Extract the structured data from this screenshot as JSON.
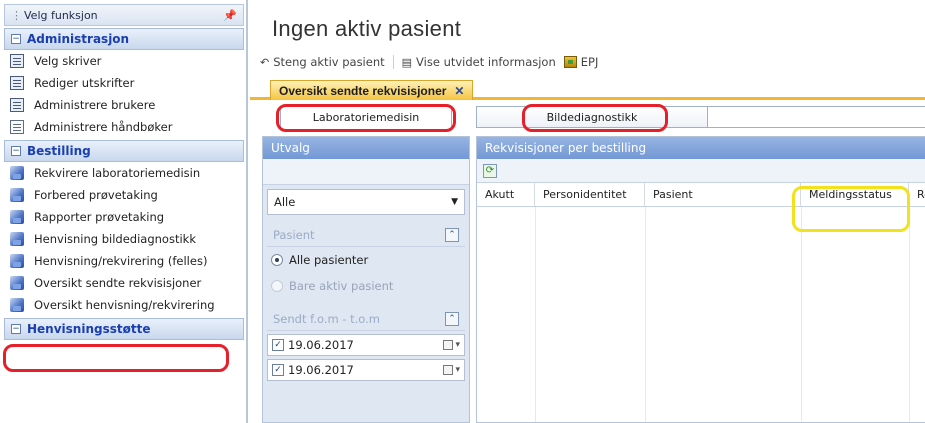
{
  "sidebar": {
    "header": "Velg funksjon",
    "groups": [
      {
        "label": "Administrasjon",
        "items": [
          {
            "label": "Velg skriver",
            "icon": "document-icon"
          },
          {
            "label": "Rediger utskrifter",
            "icon": "document-icon"
          },
          {
            "label": "Administrere brukere",
            "icon": "document-icon"
          },
          {
            "label": "Administrere håndbøker",
            "icon": "book-icon"
          }
        ]
      },
      {
        "label": "Bestilling",
        "items": [
          {
            "label": "Rekvirere laboratoriemedisin",
            "icon": "lab-icon"
          },
          {
            "label": "Forbered prøvetaking",
            "icon": "lab-icon"
          },
          {
            "label": "Rapporter prøvetaking",
            "icon": "lab-icon"
          },
          {
            "label": "Henvisning bildediagnostikk",
            "icon": "lab-icon"
          },
          {
            "label": "Henvisning/rekvirering (felles)",
            "icon": "lab-icon"
          },
          {
            "label": "Oversikt sendte rekvisisjoner",
            "icon": "lab-icon"
          },
          {
            "label": "Oversikt henvisning/rekvirering",
            "icon": "lab-icon"
          }
        ]
      },
      {
        "label": "Henvisningsstøtte",
        "items": []
      }
    ]
  },
  "main": {
    "title": "Ingen aktiv pasient",
    "toolbar": {
      "close_patient": "Steng aktiv pasient",
      "show_info": "Vise utvidet informasjon",
      "epj": "EPJ"
    },
    "doc_tab": "Oversikt sendte rekvisisjoner",
    "subtabs": [
      "Laboratoriemedisin",
      "Bildediagnostikk"
    ],
    "filter": {
      "header": "Utvalg",
      "select_value": "Alle",
      "patient_section": "Pasient",
      "radio_all": "Alle pasienter",
      "radio_active": "Bare aktiv pasient",
      "sent_section": "Sendt f.o.m - t.o.m",
      "date_from": "19.06.2017",
      "date_to": "19.06.2017"
    },
    "grid": {
      "header": "Rekvisisjoner per bestilling",
      "columns": [
        "Akutt",
        "Personidentitet",
        "Pasient",
        "Meldingsstatus",
        "Re"
      ]
    }
  },
  "colors": {
    "highlight_red": "#e5202a",
    "highlight_yellow": "#f1e21b",
    "active_tab": "#f4c440",
    "panel_header": "#7398d4",
    "group_text": "#1a3fae"
  }
}
